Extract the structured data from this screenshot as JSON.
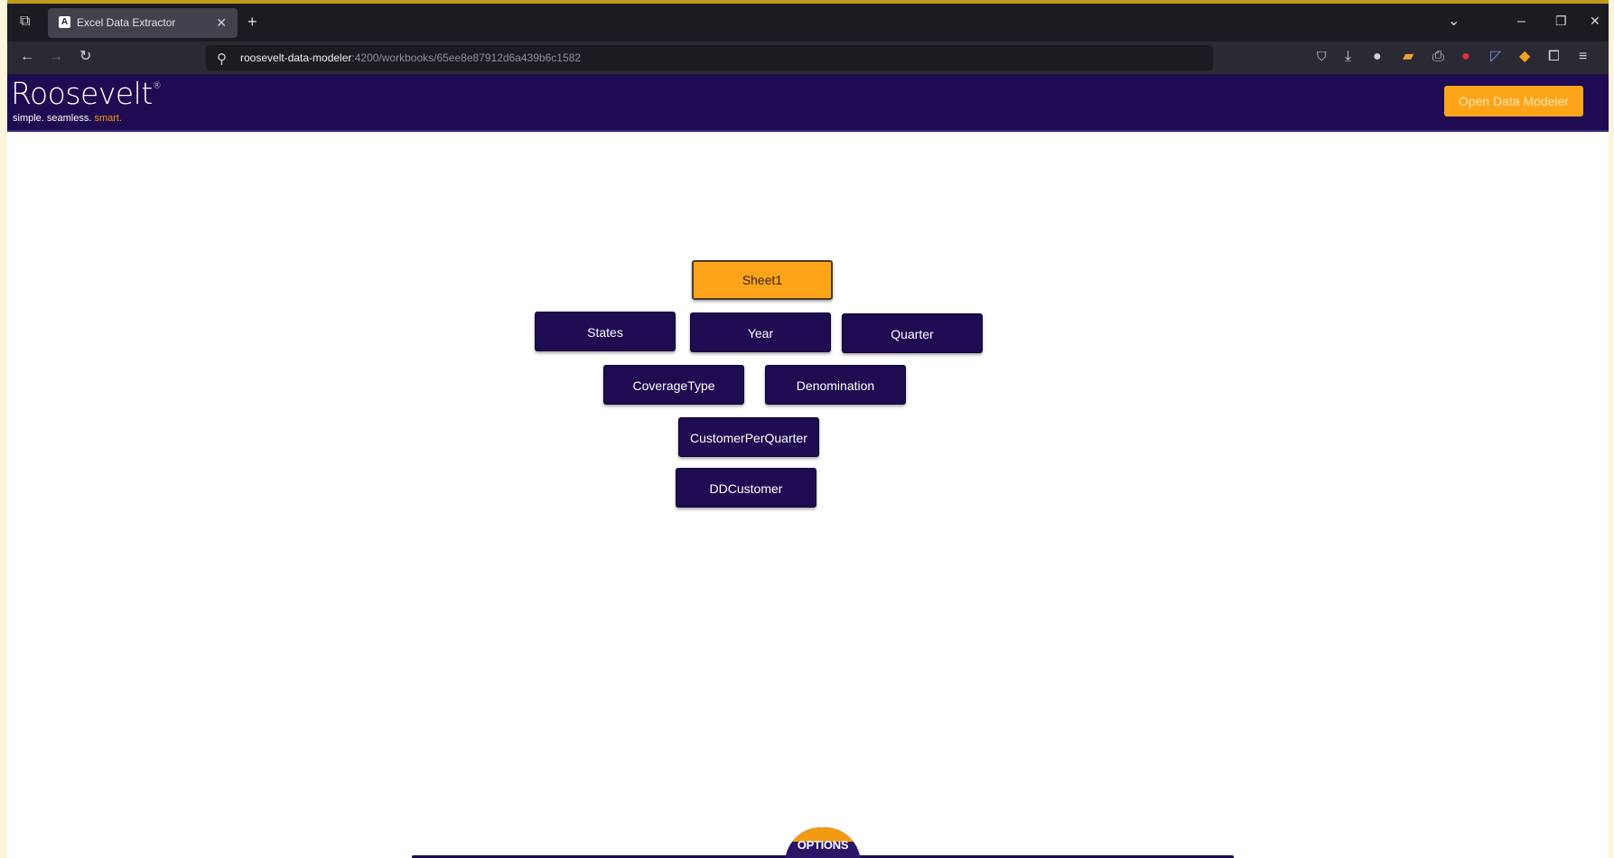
{
  "browser": {
    "tab_title": "Excel Data Extractor",
    "tab_favicon_letter": "A",
    "url_host": "roosevelt-data-modeler",
    "url_path": ":4200/workbooks/65ee8e87912d6a439b6c1582"
  },
  "header": {
    "logo_text": "Roosevelt",
    "logo_mark": "®",
    "tagline_plain": "simple. seamless.",
    "tagline_accent": "smart.",
    "open_button_label": "Open Data Modeler",
    "brand_color": "#1e0b52",
    "accent_color": "#fda419"
  },
  "nodes": {
    "root": "Sheet1",
    "states": "States",
    "year": "Year",
    "quarter": "Quarter",
    "coverage_type": "CoverageType",
    "denomination": "Denomination",
    "customer_per_quarter": "CustomerPerQuarter",
    "dd_customer": "DDCustomer"
  },
  "options": {
    "label": "OPTIONS"
  }
}
